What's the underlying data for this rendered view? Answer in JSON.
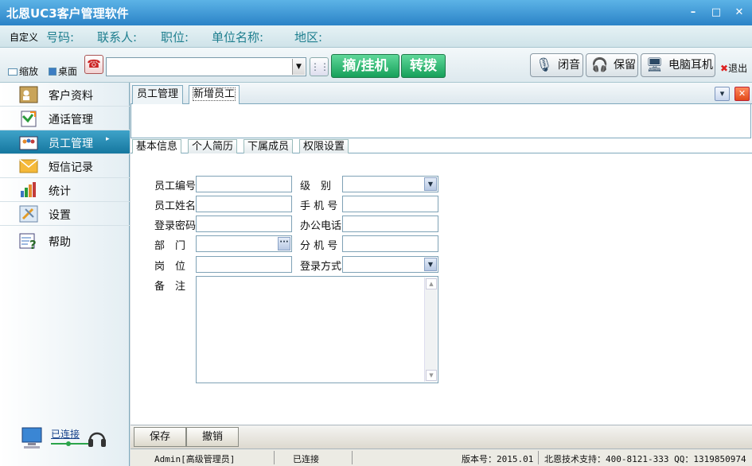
{
  "window": {
    "title": "北恩UC3客户管理软件",
    "minimize": "–",
    "maximize": "□",
    "close": "✕"
  },
  "infobar": {
    "custom": "自定义",
    "fields": [
      "号码:",
      "联系人:",
      "职位:",
      "单位名称:",
      "地区:"
    ]
  },
  "toolbar": {
    "zoom_label": "缩放",
    "desktop_label": "桌面",
    "pickup_label": "摘/挂机",
    "transfer_label": "转拨",
    "mute_label": "闭音",
    "hold_label": "保留",
    "pc_headset_label": "电脑耳机",
    "exit_label": "退出"
  },
  "sidebar": {
    "items": [
      {
        "label": "客户资料"
      },
      {
        "label": "通话管理"
      },
      {
        "label": "员工管理"
      },
      {
        "label": "短信记录"
      },
      {
        "label": "统计"
      },
      {
        "label": "设置"
      },
      {
        "label": "帮助"
      }
    ],
    "connection": "已连接"
  },
  "tabs": [
    {
      "label": "员工管理"
    },
    {
      "label": "新增员工"
    }
  ],
  "subtabs": [
    {
      "label": "基本信息"
    },
    {
      "label": "个人简历"
    },
    {
      "label": "下属成员"
    },
    {
      "label": "权限设置"
    }
  ],
  "form": {
    "emp_no": "员工编号",
    "level": "级　别",
    "name": "员工姓名",
    "mobile": "手 机 号",
    "password": "登录密码",
    "office_phone": "办公电话",
    "dept": "部　门",
    "extension": "分 机 号",
    "post": "岗　位",
    "login_mode": "登录方式",
    "remark": "备　注"
  },
  "buttons": {
    "save": "保存",
    "cancel": "撤销"
  },
  "status": {
    "user": "Admin[高级管理员]",
    "connection": "已连接",
    "version": "版本号：2015.01",
    "support": "北恩技术支持：400-8121-333 QQ：1319850974"
  }
}
